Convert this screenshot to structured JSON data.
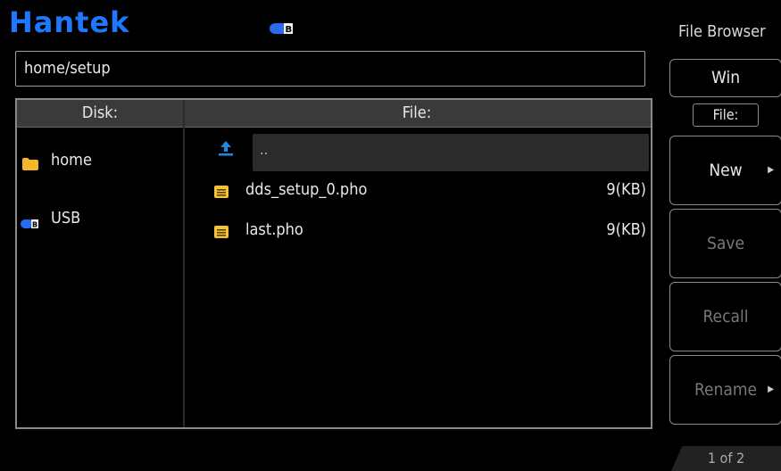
{
  "brand": {
    "logo": "Hantek",
    "color": "#1e78ff"
  },
  "window": {
    "title": "File Browser"
  },
  "path": {
    "value": "home/setup"
  },
  "disk_panel": {
    "header": "Disk:",
    "items": [
      {
        "label": "home",
        "icon": "folder-icon"
      },
      {
        "label": "USB",
        "icon": "usb-icon"
      }
    ]
  },
  "file_panel": {
    "header": "File:",
    "up_label": "..",
    "files": [
      {
        "name": "dds_setup_0.pho",
        "size": "9(KB)",
        "icon": "document-icon"
      },
      {
        "name": "last.pho",
        "size": "9(KB)",
        "icon": "document-icon"
      }
    ]
  },
  "softkeys": {
    "win": "Win",
    "file_label": "File:",
    "new": "New",
    "save": "Save",
    "recall": "Recall",
    "rename": "Rename"
  },
  "page_indicator": "1 of 2"
}
